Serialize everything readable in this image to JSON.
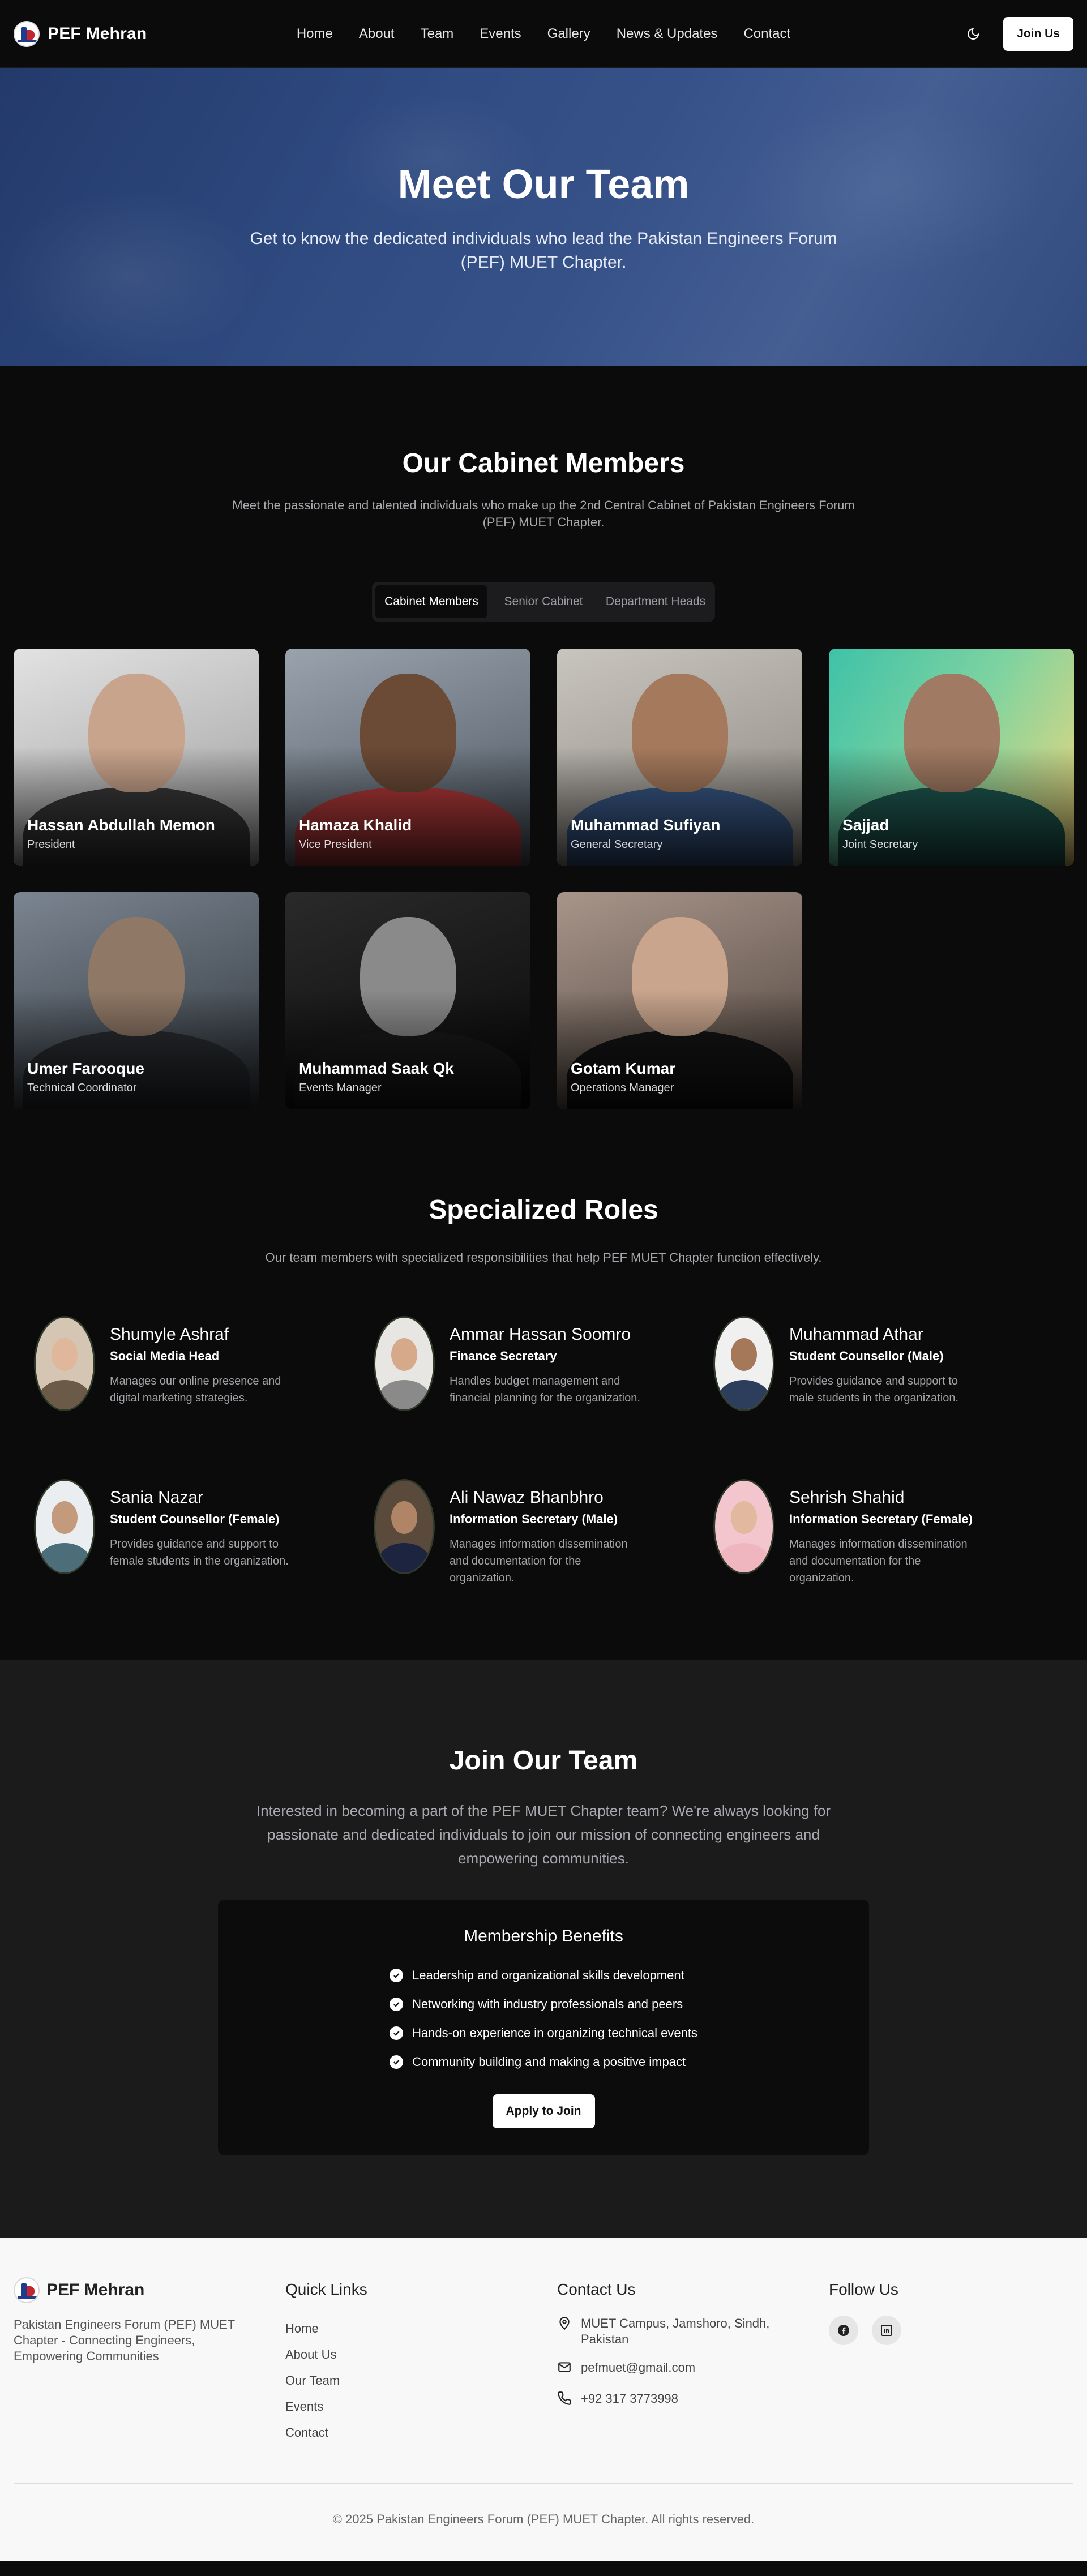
{
  "nav": {
    "brand": "PEF Mehran",
    "links": [
      "Home",
      "About",
      "Team",
      "Events",
      "Gallery",
      "News & Updates",
      "Contact"
    ],
    "join_label": "Join Us"
  },
  "hero": {
    "title": "Meet Our Team",
    "subtitle": "Get to know the dedicated individuals who lead the Pakistan Engineers Forum (PEF) MUET Chapter."
  },
  "cabinet": {
    "title": "Our Cabinet Members",
    "subtitle": "Meet the passionate and talented individuals who make up the 2nd Central Cabinet of Pakistan Engineers Forum (PEF) MUET Chapter.",
    "tabs": [
      "Cabinet Members",
      "Senior Cabinet",
      "Department Heads"
    ],
    "members": [
      {
        "name": "Hassan Abdullah Memon",
        "role": "President"
      },
      {
        "name": "Hamaza Khalid",
        "role": "Vice President"
      },
      {
        "name": "Muhammad Sufiyan",
        "role": "General Secretary"
      },
      {
        "name": "Sajjad",
        "role": "Joint Secretary"
      },
      {
        "name": "Umer Farooque",
        "role": "Technical Coordinator"
      },
      {
        "name": "Muhammad Saak Qk",
        "role": "Events Manager"
      },
      {
        "name": "Gotam Kumar",
        "role": "Operations Manager"
      }
    ]
  },
  "specialized": {
    "title": "Specialized Roles",
    "subtitle": "Our team members with specialized responsibilities that help PEF MUET Chapter function effectively.",
    "roles": [
      {
        "name": "Shumyle Ashraf",
        "title": "Social Media Head",
        "desc": "Manages our online presence and digital marketing strategies."
      },
      {
        "name": "Ammar Hassan Soomro",
        "title": "Finance Secretary",
        "desc": "Handles budget management and financial planning for the organization."
      },
      {
        "name": "Muhammad Athar",
        "title": "Student Counsellor (Male)",
        "desc": "Provides guidance and support to male students in the organization."
      },
      {
        "name": "Sania Nazar",
        "title": "Student Counsellor (Female)",
        "desc": "Provides guidance and support to female students in the organization."
      },
      {
        "name": "Ali Nawaz Bhanbhro",
        "title": "Information Secretary (Male)",
        "desc": "Manages information dissemination and documentation for the organization."
      },
      {
        "name": "Sehrish Shahid",
        "title": "Information Secretary (Female)",
        "desc": "Manages information dissemination and documentation for the organization."
      }
    ]
  },
  "join": {
    "title": "Join Our Team",
    "lead": "Interested in becoming a part of the PEF MUET Chapter team? We're always looking for passionate and dedicated individuals to join our mission of connecting engineers and empowering communities.",
    "benefits_title": "Membership Benefits",
    "benefits": [
      "Leadership and organizational skills development",
      "Networking with industry professionals and peers",
      "Hands-on experience in organizing technical events",
      "Community building and making a positive impact"
    ],
    "apply_label": "Apply to Join"
  },
  "footer": {
    "brand": "PEF Mehran",
    "desc": "Pakistan Engineers Forum (PEF) MUET Chapter - Connecting Engineers, Empowering Communities",
    "quick_links_title": "Quick Links",
    "quick_links": [
      "Home",
      "About Us",
      "Our Team",
      "Events",
      "Contact"
    ],
    "contact_title": "Contact Us",
    "address": "MUET Campus, Jamshoro, Sindh, Pakistan",
    "email": "pefmuet@gmail.com",
    "phone": "+92 317 3773998",
    "follow_title": "Follow Us",
    "social_icons": [
      "facebook-icon",
      "linkedin-icon"
    ],
    "copyright": "© 2025 Pakistan Engineers Forum (PEF) MUET Chapter. All rights reserved."
  }
}
